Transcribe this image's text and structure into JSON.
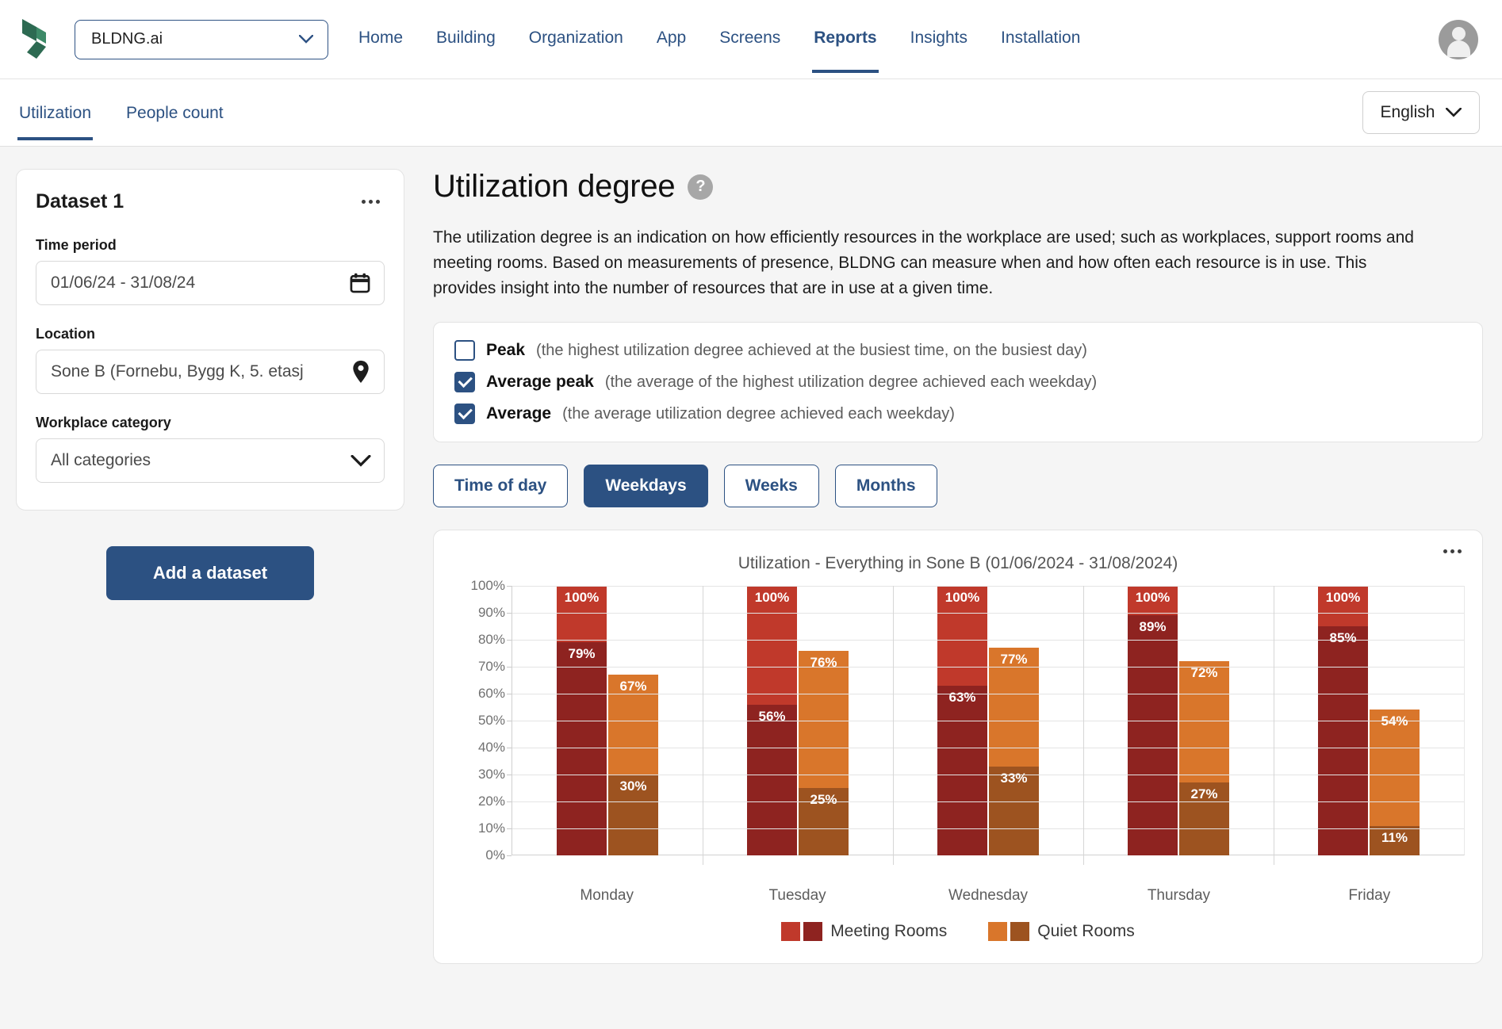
{
  "header": {
    "logo_icon": "bldng-logo-icon",
    "brand_select": {
      "value": "BLDNG.ai",
      "icon": "chevron-down-icon"
    },
    "nav": [
      {
        "label": "Home",
        "active": false
      },
      {
        "label": "Building",
        "active": false
      },
      {
        "label": "Organization",
        "active": false
      },
      {
        "label": "App",
        "active": false
      },
      {
        "label": "Screens",
        "active": false
      },
      {
        "label": "Reports",
        "active": true
      },
      {
        "label": "Insights",
        "active": false
      },
      {
        "label": "Installation",
        "active": false
      }
    ],
    "avatar_icon": "user-avatar-icon"
  },
  "subheader": {
    "tabs": [
      {
        "label": "Utilization",
        "active": true
      },
      {
        "label": "People count",
        "active": false
      }
    ],
    "language": {
      "value": "English",
      "icon": "chevron-down-icon"
    }
  },
  "sidebar": {
    "dataset": {
      "title": "Dataset 1",
      "menu_icon": "more-options-icon",
      "fields": [
        {
          "label": "Time period",
          "value": "01/06/24 - 31/08/24",
          "icon": "calendar-icon"
        },
        {
          "label": "Location",
          "value": "Sone B (Fornebu, Bygg K, 5. etasj",
          "icon": "location-pin-icon"
        },
        {
          "label": "Workplace category",
          "value": "All categories",
          "icon": "chevron-down-icon"
        }
      ]
    },
    "add_dataset_label": "Add a dataset"
  },
  "main": {
    "title": "Utilization degree",
    "help_icon": "question-mark-icon",
    "description": "The utilization degree is an indication on how efficiently resources in the workplace are used; such as workplaces, support rooms and meeting rooms. Based on measurements of presence, BLDNG can measure when and how often each resource is in use. This provides insight into the number of resources that are in use at a given time.",
    "options": [
      {
        "name": "Peak",
        "desc": "(the highest utilization degree achieved at the busiest time, on the busiest day)",
        "checked": false
      },
      {
        "name": "Average peak",
        "desc": "(the average of the highest utilization degree achieved each weekday)",
        "checked": true
      },
      {
        "name": "Average",
        "desc": "(the average utilization degree achieved each weekday)",
        "checked": true
      }
    ],
    "segments": [
      {
        "label": "Time of day",
        "active": false
      },
      {
        "label": "Weekdays",
        "active": true
      },
      {
        "label": "Weeks",
        "active": false
      },
      {
        "label": "Months",
        "active": false
      }
    ],
    "chart_menu_icon": "more-options-icon"
  },
  "chart_data": {
    "type": "bar",
    "title": "Utilization - Everything in Sone B (01/06/2024 - 31/08/2024)",
    "xlabel": "",
    "ylabel": "",
    "ylim": [
      0,
      100
    ],
    "grid": true,
    "stacked": true,
    "legend_position": "bottom",
    "categories": [
      "Monday",
      "Tuesday",
      "Wednesday",
      "Thursday",
      "Friday"
    ],
    "ticks": [
      "0%",
      "10%",
      "20%",
      "30%",
      "40%",
      "50%",
      "60%",
      "70%",
      "80%",
      "90%",
      "100%"
    ],
    "series": [
      {
        "name": "Meeting Rooms",
        "metric": "Average peak",
        "color": "#c0392b",
        "values": [
          100,
          100,
          100,
          100,
          100
        ],
        "labels": [
          "100%",
          "100%",
          "100%",
          "100%",
          "100%"
        ]
      },
      {
        "name": "Meeting Rooms",
        "metric": "Average",
        "color": "#8e2320",
        "values": [
          79,
          56,
          63,
          89,
          85
        ],
        "labels": [
          "79%",
          "56%",
          "63%",
          "89%",
          "85%"
        ]
      },
      {
        "name": "Quiet Rooms",
        "metric": "Average peak",
        "color": "#d9762b",
        "values": [
          67,
          76,
          77,
          72,
          54
        ],
        "labels": [
          "67%",
          "76%",
          "77%",
          "72%",
          "54%"
        ]
      },
      {
        "name": "Quiet Rooms",
        "metric": "Average",
        "color": "#9d5320",
        "values": [
          30,
          25,
          33,
          27,
          11
        ],
        "labels": [
          "30%",
          "25%",
          "33%",
          "27%",
          "11%"
        ]
      }
    ],
    "legend": [
      {
        "label": "Meeting Rooms",
        "colors": [
          "#c0392b",
          "#8e2320"
        ]
      },
      {
        "label": "Quiet Rooms",
        "colors": [
          "#d9762b",
          "#9d5320"
        ]
      }
    ]
  }
}
